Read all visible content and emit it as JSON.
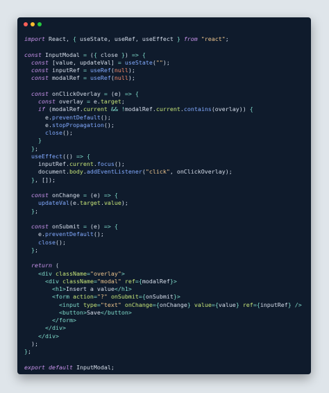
{
  "window": {
    "buttons": [
      "close",
      "minimize",
      "maximize"
    ]
  },
  "code": {
    "language": "jsx",
    "lines": [
      "import React, { useState, useRef, useEffect } from \"react\";",
      "",
      "const InputModal = ({ close }) => {",
      "  const [value, updateVal] = useState(\"\");",
      "  const inputRef = useRef(null);",
      "  const modalRef = useRef(null);",
      "",
      "  const onClickOverlay = (e) => {",
      "    const overlay = e.target;",
      "    if (modalRef.current && !modalRef.current.contains(overlay)) {",
      "      e.preventDefault();",
      "      e.stopPropagation();",
      "      close();",
      "    }",
      "  };",
      "  useEffect(() => {",
      "    inputRef.current.focus();",
      "    document.body.addEventListener(\"click\", onClickOverlay);",
      "  }, []);",
      "",
      "  const onChange = (e) => {",
      "    updateVal(e.target.value);",
      "  };",
      "",
      "  const onSubmit = (e) => {",
      "    e.preventDefault();",
      "    close();",
      "  };",
      "",
      "  return (",
      "    <div className=\"overlay\">",
      "      <div className=\"modal\" ref={modalRef}>",
      "        <h1>Insert a value</h1>",
      "        <form action=\"?\" onSubmit={onSubmit}>",
      "          <input type=\"text\" onChange={onChange} value={value} ref={inputRef} />",
      "          <button>Save</button>",
      "        </form>",
      "      </div>",
      "    </div>",
      "  );",
      "};",
      "",
      "export default InputModal;"
    ]
  },
  "colors": {
    "background": "#dfe5ea",
    "editor": "#0f1b2c",
    "text": "#d6deeb",
    "keyword": "#c792ea",
    "string": "#ecc48d",
    "number": "#f78c6c",
    "function": "#82aaff",
    "tag": "#7fdbca",
    "attribute": "#c5e478"
  }
}
